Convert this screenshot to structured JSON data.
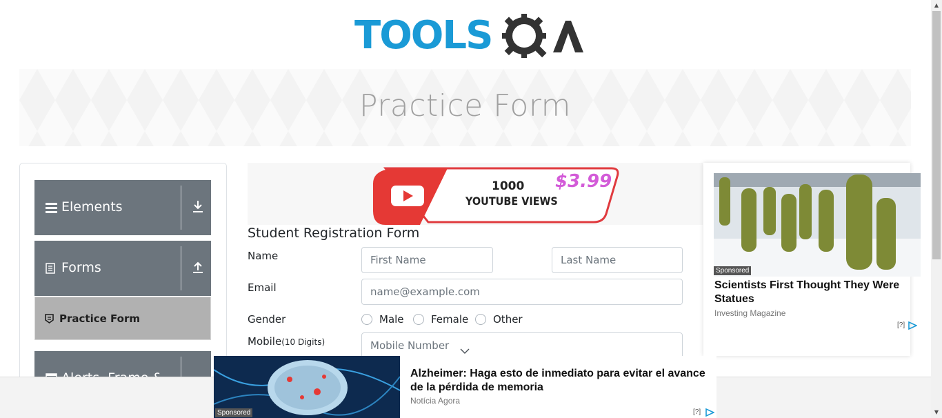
{
  "logo": {
    "text": "TOOLS",
    "accent": "#1a9ad6",
    "qa_color": "#333333",
    "icon": "gear-magnifier-icon"
  },
  "banner": {
    "title": "Practice Form"
  },
  "sidebar": {
    "groups": [
      {
        "label": "Elements",
        "icon": "hamburger-icon",
        "arrow": "download-arrow-icon"
      },
      {
        "label": "Forms",
        "icon": "document-icon",
        "arrow": "upload-arrow-icon"
      },
      {
        "label": "Alerts, Frame & Windows",
        "icon": "window-icon",
        "arrow": "download-arrow-icon"
      }
    ],
    "active_item": {
      "label": "Practice Form",
      "icon": "badge-icon"
    }
  },
  "top_ad": {
    "line1": "1000",
    "line2": "YOUTUBE VIEWS",
    "price": "$3.99"
  },
  "form": {
    "title": "Student Registration Form",
    "name_label": "Name",
    "first_name_placeholder": "First Name",
    "last_name_placeholder": "Last Name",
    "email_label": "Email",
    "email_placeholder": "name@example.com",
    "gender_label": "Gender",
    "gender_options": [
      "Male",
      "Female",
      "Other"
    ],
    "mobile_label": "Mobile",
    "mobile_hint": "(10 Digits)",
    "mobile_placeholder": "Mobile Number"
  },
  "right_ad": {
    "tag": "Sponsored",
    "headline": "Scientists First Thought They Were Statues",
    "source": "Investing Magazine",
    "info": "[?]"
  },
  "bottom_ad": {
    "tag": "Sponsored",
    "headline": "Alzheimer: Haga esto de inmediato para evitar el avance de la pérdida de memoria",
    "source": "Notícia Agora",
    "info": "[?]"
  }
}
